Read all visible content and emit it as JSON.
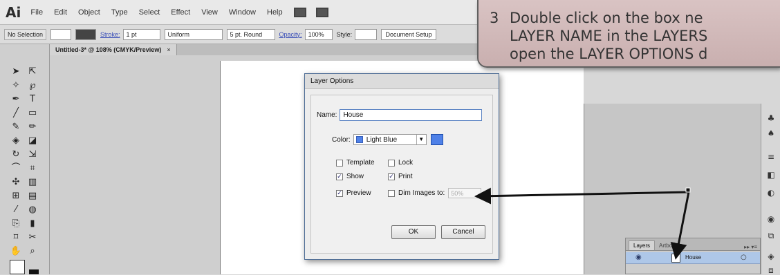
{
  "app": {
    "logo": "Ai"
  },
  "menubar": {
    "items": [
      "File",
      "Edit",
      "Object",
      "Type",
      "Select",
      "Effect",
      "View",
      "Window",
      "Help"
    ]
  },
  "control_bar": {
    "selection": "No Selection",
    "stroke_label": "Stroke:",
    "stroke_value": "1 pt",
    "profile": "Uniform",
    "brush": "5 pt. Round",
    "opacity_label": "Opacity:",
    "opacity_value": "100%",
    "style_label": "Style:",
    "doc_setup": "Document Setup"
  },
  "document_tab": {
    "title": "Untitled-3* @ 108% (CMYK/Preview)",
    "close": "×"
  },
  "dialog": {
    "title": "Layer Options",
    "name_label": "Name:",
    "name_value": "House",
    "color_label": "Color:",
    "color_value": "Light Blue",
    "color_hex": "#4f81e8",
    "template_label": "Template",
    "lock_label": "Lock",
    "show_label": "Show",
    "print_label": "Print",
    "preview_label": "Preview",
    "dim_label": "Dim Images to:",
    "dim_value": "50%",
    "ok_label": "OK",
    "cancel_label": "Cancel",
    "check_mark": "✓"
  },
  "callout": {
    "number": "3",
    "line1": "Double click on the box ne",
    "line2": "LAYER NAME in the LAYERS",
    "line3": "open the LAYER OPTIONS d"
  },
  "layers_panel": {
    "tab_layers": "Layers",
    "tab_artboards": "Artboa",
    "menu": "▸▸ ▾≡",
    "layer_name": "House",
    "eye_glyph": "◉",
    "target_glyph": "○"
  },
  "toolbar": {
    "tools": [
      "selection-tool-icon",
      "direct-selection-tool-icon",
      "magic-wand-icon",
      "lasso-icon",
      "pen-icon",
      "type-icon",
      "line-icon",
      "rectangle-icon",
      "brush-icon",
      "pencil-icon",
      "blob-brush-icon",
      "eraser-icon",
      "rotate-icon",
      "scale-icon",
      "warp-icon",
      "free-transform-icon",
      "symbol-sprayer-icon",
      "graph-icon",
      "mesh-icon",
      "gradient-icon",
      "eyedropper-icon",
      "blend-icon",
      "slice-icon",
      "column-graph-icon",
      "artboard-icon",
      "scissors-icon",
      "hand-icon",
      "zoom-icon"
    ]
  },
  "colors": {
    "callout_bg": "#d2b9b9",
    "selection_highlight": "#aec7e8",
    "accent_blue": "#4f81e8"
  }
}
